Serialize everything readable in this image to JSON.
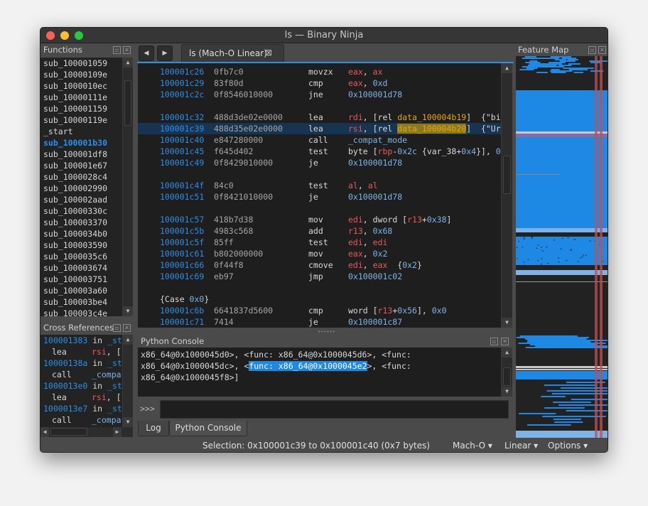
{
  "window": {
    "title": "ls — Binary Ninja",
    "traffic": [
      "#fe5f57",
      "#febc2e",
      "#28c840"
    ]
  },
  "colors": {
    "accent": "#2a8fe8",
    "register": "#e65a5a",
    "number": "#7db4e6",
    "symbol": "#e8a30e",
    "selection": "#173552"
  },
  "functions": {
    "title": "Functions",
    "items": [
      "sub_100001059",
      "sub_10000109e",
      "sub_1000010ec",
      "sub_10000111e",
      "sub_100001159",
      "sub_10000119e",
      "_start",
      "sub_100001b30",
      "sub_100001df8",
      "sub_100001e67",
      "sub_1000028c4",
      "sub_100002990",
      "sub_100002aad",
      "sub_10000330c",
      "sub_100003370",
      "sub_1000034b0",
      "sub_100003590",
      "sub_1000035c6",
      "sub_100003674",
      "sub_100003751",
      "sub_100003a60",
      "sub_100003be4",
      "sub_100003c4e"
    ],
    "selected": 7
  },
  "xrefs": {
    "title": "Cross References",
    "items": [
      {
        "addr": "100001383",
        "in": "in",
        "fn": "_st",
        "mn": "lea",
        "op": [
          [
            "reg",
            "rsi"
          ],
          [
            "txt",
            ", ["
          ]
        ]
      },
      {
        "addr": "10000138a",
        "in": "in",
        "fn": "_st",
        "mn": "call",
        "op": [
          [
            "addr",
            "_compa"
          ]
        ]
      },
      {
        "addr": "1000013e0",
        "in": "in",
        "fn": "_st",
        "mn": "lea",
        "op": [
          [
            "reg",
            "rsi"
          ],
          [
            "txt",
            ", ["
          ]
        ]
      },
      {
        "addr": "1000013e7",
        "in": "in",
        "fn": "_st",
        "mn": "call",
        "op": [
          [
            "addr",
            "_compa"
          ]
        ]
      }
    ]
  },
  "nav": {
    "back": "◀",
    "forward": "▶"
  },
  "tab": {
    "label": "ls (Mach-O Linear)",
    "close": "⊠"
  },
  "disassembly": {
    "selected_row": 5,
    "rows": [
      {
        "addr": "100001c26",
        "bytes": "0fb7c0",
        "mn": "movzx",
        "ops": [
          [
            "reg",
            "eax"
          ],
          [
            "txt",
            ", "
          ],
          [
            "reg",
            "ax"
          ]
        ]
      },
      {
        "addr": "100001c29",
        "bytes": "83f80d",
        "mn": "cmp",
        "ops": [
          [
            "reg",
            "eax"
          ],
          [
            "txt",
            ", "
          ],
          [
            "num",
            "0xd"
          ]
        ]
      },
      {
        "addr": "100001c2c",
        "bytes": "0f8546010000",
        "mn": "jne",
        "ops": [
          [
            "addr",
            "0x100001d78"
          ]
        ]
      },
      {
        "blank": true
      },
      {
        "addr": "100001c32",
        "bytes": "488d3de02e0000",
        "mn": "lea",
        "ops": [
          [
            "reg",
            "rdi"
          ],
          [
            "txt",
            ", [rel "
          ],
          [
            "sym",
            "data_100004b19"
          ],
          [
            "txt",
            "]  {\"bi"
          ]
        ]
      },
      {
        "addr": "100001c39",
        "bytes": "488d35e02e0000",
        "mn": "lea",
        "ops": [
          [
            "reg",
            "rsi"
          ],
          [
            "txt",
            ", [rel "
          ],
          [
            "hl",
            "data_100004b20"
          ],
          [
            "txt",
            "]  {\"Ur"
          ]
        ]
      },
      {
        "addr": "100001c40",
        "bytes": "e847280000",
        "mn": "call",
        "ops": [
          [
            "addr",
            "_compat_mode"
          ]
        ]
      },
      {
        "addr": "100001c45",
        "bytes": "f645d402",
        "mn": "test",
        "ops": [
          [
            "txt",
            "byte ["
          ],
          [
            "reg",
            "rbp"
          ],
          [
            "txt",
            "-"
          ],
          [
            "num",
            "0x2c"
          ],
          [
            "txt",
            " {var_38+"
          ],
          [
            "num",
            "0x4"
          ],
          [
            "txt",
            "}], "
          ],
          [
            "num",
            "0"
          ]
        ]
      },
      {
        "addr": "100001c49",
        "bytes": "0f8429010000",
        "mn": "je",
        "ops": [
          [
            "addr",
            "0x100001d78"
          ]
        ]
      },
      {
        "blank": true
      },
      {
        "addr": "100001c4f",
        "bytes": "84c0",
        "mn": "test",
        "ops": [
          [
            "reg",
            "al"
          ],
          [
            "txt",
            ", "
          ],
          [
            "reg",
            "al"
          ]
        ]
      },
      {
        "addr": "100001c51",
        "bytes": "0f8421010000",
        "mn": "je",
        "ops": [
          [
            "addr",
            "0x100001d78"
          ]
        ]
      },
      {
        "blank": true
      },
      {
        "addr": "100001c57",
        "bytes": "418b7d38",
        "mn": "mov",
        "ops": [
          [
            "reg",
            "edi"
          ],
          [
            "txt",
            ", dword ["
          ],
          [
            "reg",
            "r13"
          ],
          [
            "txt",
            "+"
          ],
          [
            "num",
            "0x38"
          ],
          [
            "txt",
            "]"
          ]
        ]
      },
      {
        "addr": "100001c5b",
        "bytes": "4983c568",
        "mn": "add",
        "ops": [
          [
            "reg",
            "r13"
          ],
          [
            "txt",
            ", "
          ],
          [
            "num",
            "0x68"
          ]
        ]
      },
      {
        "addr": "100001c5f",
        "bytes": "85ff",
        "mn": "test",
        "ops": [
          [
            "reg",
            "edi"
          ],
          [
            "txt",
            ", "
          ],
          [
            "reg",
            "edi"
          ]
        ]
      },
      {
        "addr": "100001c61",
        "bytes": "b802000000",
        "mn": "mov",
        "ops": [
          [
            "reg",
            "eax"
          ],
          [
            "txt",
            ", "
          ],
          [
            "num",
            "0x2"
          ]
        ]
      },
      {
        "addr": "100001c66",
        "bytes": "0f44f8",
        "mn": "cmove",
        "ops": [
          [
            "reg",
            "edi"
          ],
          [
            "txt",
            ", "
          ],
          [
            "reg",
            "eax"
          ],
          [
            "txt",
            "  {"
          ],
          [
            "num",
            "0x2"
          ],
          [
            "txt",
            "}"
          ]
        ]
      },
      {
        "addr": "100001c69",
        "bytes": "eb97",
        "mn": "jmp",
        "ops": [
          [
            "addr",
            "0x100001c02"
          ]
        ]
      },
      {
        "blank": true
      },
      {
        "label": [
          [
            "txt",
            "{Case "
          ],
          [
            "num",
            "0x0"
          ],
          [
            "txt",
            "}"
          ]
        ]
      },
      {
        "addr": "100001c6b",
        "bytes": "6641837d5600",
        "mn": "cmp",
        "ops": [
          [
            "txt",
            "word ["
          ],
          [
            "reg",
            "r13"
          ],
          [
            "txt",
            "+"
          ],
          [
            "num",
            "0x56"
          ],
          [
            "txt",
            "], "
          ],
          [
            "num",
            "0x0"
          ]
        ]
      },
      {
        "addr": "100001c71",
        "bytes": "7414",
        "mn": "je",
        "ops": [
          [
            "addr",
            "0x100001c87"
          ]
        ]
      }
    ]
  },
  "console": {
    "title": "Python Console",
    "lines": [
      [
        [
          "txt",
          "x86_64@0x1000045d0>, <func: x86_64@0x1000045d6>, <func:"
        ]
      ],
      [
        [
          "txt",
          "x86_64@0x1000045dc>, <"
        ],
        [
          "sel",
          "func: x86_64@0x1000045e2"
        ],
        [
          "txt",
          ">, <func:"
        ]
      ],
      [
        [
          "txt",
          "x86_64@0x1000045f8>]"
        ]
      ]
    ],
    "prompt": ">>>",
    "input": ""
  },
  "bottom_tabs": [
    "Log",
    "Python Console"
  ],
  "bottom_active": 1,
  "feature_map": {
    "title": "Feature Map",
    "colors": {
      "code": "#1e88e5",
      "data": "#7fb3e6",
      "string": "#c8c8c8",
      "cursor": "#c05050"
    }
  },
  "status": {
    "selection": "Selection: 0x100001c39 to 0x100001c40 (0x7 bytes)",
    "platform": "Mach-O ▾",
    "view": "Linear ▾",
    "options": "Options ▾"
  }
}
